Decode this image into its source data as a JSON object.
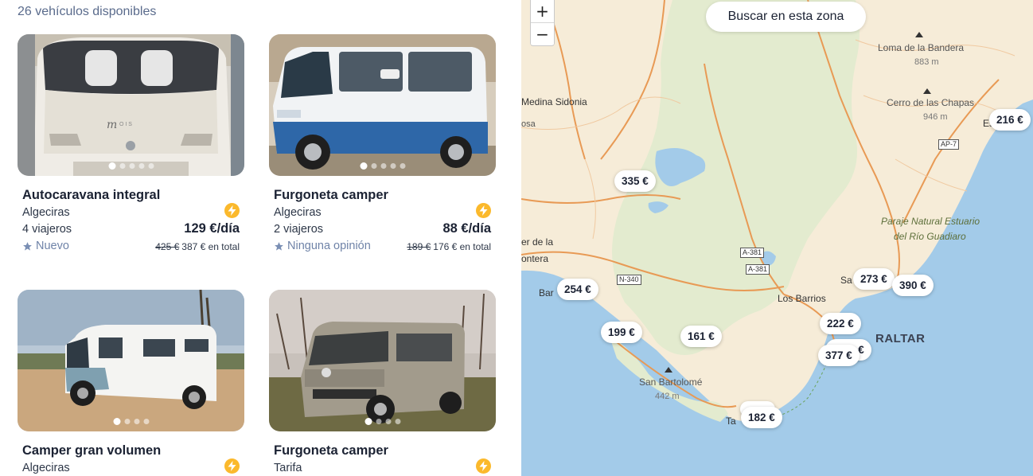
{
  "results": {
    "count_text": "26 vehículos disponibles"
  },
  "listings": [
    {
      "title": "Autocaravana integral",
      "location": "Algeciras",
      "travelers": "4 viajeros",
      "price": "129 €/día",
      "rating": "Nuevo",
      "old_total": "425 €",
      "new_total": "387 € en total"
    },
    {
      "title": "Furgoneta camper",
      "location": "Algeciras",
      "travelers": "2 viajeros",
      "price": "88 €/día",
      "rating": "Ninguna opinión",
      "old_total": "189 €",
      "new_total": "176 € en total"
    },
    {
      "title": "Camper gran volumen",
      "location": "Algeciras"
    },
    {
      "title": "Furgoneta camper",
      "location": "Tarifa"
    }
  ],
  "map": {
    "zoom_in": "+",
    "zoom_out": "−",
    "search_button": "Buscar en esta zona",
    "pins": [
      "335 €",
      "254 €",
      "199 €",
      "161 €",
      "222 €",
      "3 €",
      "377 €",
      "182 €",
      "273 €",
      "390 €",
      "216 €"
    ],
    "places": {
      "medina": "Medina Sidonia",
      "osa": "osa",
      "loma": "Loma de la Bandera",
      "loma_alt": "883 m",
      "cerro": "Cerro de las Chapas",
      "cerro_alt": "946 m",
      "es": "Es",
      "paraje1": "Paraje Natural Estuario",
      "paraje2": "del Río Guadiaro",
      "vejer1": "er de la",
      "vejer2": "ontera",
      "barbate": "Bar",
      "barrios": "Los Barrios",
      "sa": "Sa",
      "gibraltar": "RALTAR",
      "bartolome": "San Bartolomé",
      "bartolome_alt": "442 m",
      "tarifa": "Ta"
    },
    "roads": {
      "a381a": "A-381",
      "a381b": "A-381",
      "n340": "N-340",
      "ap7": "AP-7"
    }
  },
  "colors": {
    "sea": "#a3cbe9",
    "land": "#f6ecd8",
    "park": "#e3ebcf",
    "road": "#e89a55",
    "bolt": "#fbb92c"
  }
}
